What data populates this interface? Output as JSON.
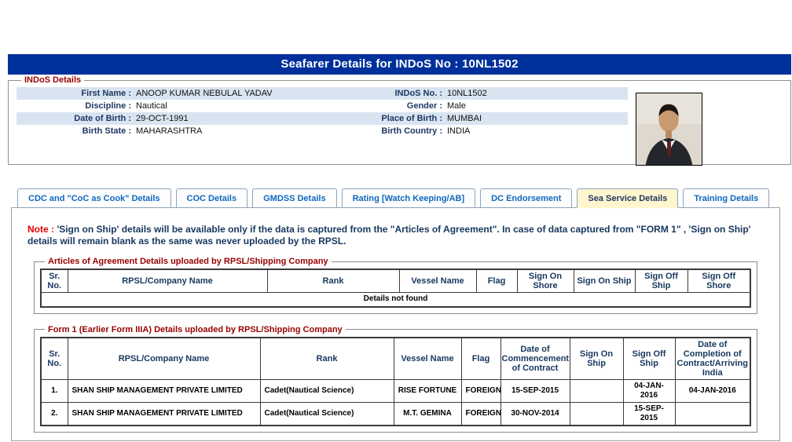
{
  "page": {
    "title": "Seafarer Details for INDoS No : 10NL1502"
  },
  "colors": {
    "header_bg": "#00309C",
    "row_alternate_bg": "#D8E4F0",
    "active_tab_bg": "#FFF5CE",
    "tab_text": "#0D68C1",
    "label_text": "#1F3864",
    "legend_text": "#990000",
    "alert_red": "#E00000"
  },
  "indos_details": {
    "legend": "INDoS Details",
    "rows": [
      {
        "label1": "First Name :",
        "value1": "ANOOP KUMAR NEBULAL YADAV",
        "label2": "INDoS No. :",
        "value2": "10NL1502"
      },
      {
        "label1": "Discipline :",
        "value1": "Nautical",
        "label2": "Gender :",
        "value2": "Male"
      },
      {
        "label1": "Date of Birth :",
        "value1": "29-OCT-1991",
        "label2": "Place of Birth :",
        "value2": "MUMBAI"
      },
      {
        "label1": "Birth State :",
        "value1": "MAHARASHTRA",
        "label2": "Birth Country :",
        "value2": "INDIA"
      }
    ],
    "photo": "seafarer passport photo"
  },
  "tabs": [
    {
      "label": "CDC and \"CoC as Cook\" Details",
      "active": false
    },
    {
      "label": "COC Details",
      "active": false
    },
    {
      "label": "GMDSS Details",
      "active": false
    },
    {
      "label": "Rating [Watch Keeping/AB]",
      "active": false
    },
    {
      "label": "DC Endorsement",
      "active": false
    },
    {
      "label": "Sea Service Details",
      "active": true
    },
    {
      "label": "Training Details",
      "active": false
    }
  ],
  "note": {
    "prefix": "Note :",
    "text": "'Sign on Ship' details will be available only if the data is captured from the \"Articles of Agreement\". In case of data captured from \"FORM 1\" , 'Sign on Ship' details will remain blank as the same was never uploaded by the RPSL."
  },
  "articles_table": {
    "legend": "Articles of Agreement Details uploaded by RPSL/Shipping Company",
    "headers": [
      "Sr. No.",
      "RPSL/Company Name",
      "Rank",
      "Vessel Name",
      "Flag",
      "Sign On Shore",
      "Sign On Ship",
      "Sign Off Ship",
      "Sign Off Shore"
    ],
    "empty_message": "Details not found"
  },
  "form1_table": {
    "legend": "Form 1 (Earlier Form IIIA) Details uploaded by RPSL/Shipping Company",
    "headers": [
      "Sr. No.",
      "RPSL/Company Name",
      "Rank",
      "Vessel Name",
      "Flag",
      "Date of Commencement of Contract",
      "Sign On Ship",
      "Sign Off Ship",
      "Date of Completion of Contract/Arriving India"
    ],
    "rows": [
      [
        "1.",
        "SHAN SHIP MANAGEMENT PRIVATE LIMITED",
        "Cadet(Nautical Science)",
        "RISE FORTUNE",
        "FOREIGN",
        "15-SEP-2015",
        "",
        "04-JAN-2016",
        "04-JAN-2016"
      ],
      [
        "2.",
        "SHAN SHIP MANAGEMENT PRIVATE LIMITED",
        "Cadet(Nautical Science)",
        "M.T. GEMINA",
        "FOREIGN",
        "30-NOV-2014",
        "",
        "15-SEP-2015",
        ""
      ]
    ]
  }
}
